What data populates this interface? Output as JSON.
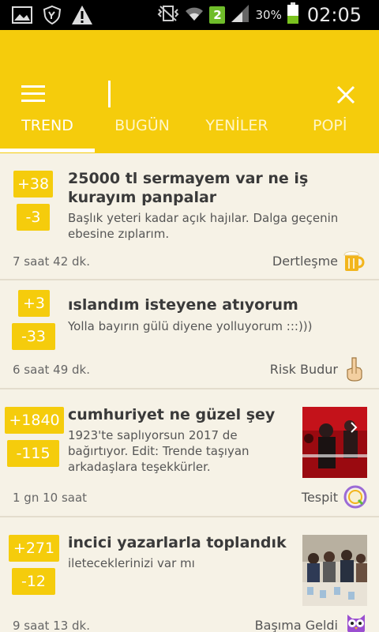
{
  "status_bar": {
    "icons_left": [
      "image-icon",
      "shield-hand-icon",
      "warning-icon"
    ],
    "icons_right": [
      "vibrate-icon",
      "wifi-icon",
      "sim2-icon",
      "signal-icon",
      "battery-icon"
    ],
    "sim_label": "2",
    "battery": "30%",
    "time": "02:05"
  },
  "app_bar": {
    "search_value": "",
    "tabs": [
      {
        "label": "TREND",
        "active": true
      },
      {
        "label": "BUGÜN",
        "active": false
      },
      {
        "label": "YENİLER",
        "active": false
      },
      {
        "label": "POPİ",
        "active": false
      }
    ]
  },
  "feed": [
    {
      "up": "+38",
      "down": "-3",
      "title": "25000 tl sermayem var ne iş kurayım panpalar",
      "body": "Başlık yeteri kadar açık hajılar. Dalga geçenin ebesine zıplarım.",
      "time": "7 saat 42 dk.",
      "category": "Dertleşme",
      "category_icon": "beer-mug-icon"
    },
    {
      "up": "+3",
      "down": "-33",
      "title": "ıslandım isteyene atıyorum",
      "body": "Yolla bayırın gülü diyene yolluyorum :::)))",
      "time": "6 saat 49 dk.",
      "category": "Risk Budur",
      "category_icon": "middle-finger-icon"
    },
    {
      "up": "+1840",
      "down": "-115",
      "title": "cumhuriyet ne güzel şey",
      "body": "1923'te saplıyorsun 2017 de bağırtıyor. Edit: Trende taşıyan arkadaşlara teşekkürler.",
      "time": "1 gn 10 saat",
      "category": "Tespit",
      "category_icon": "magnifier-icon",
      "thumbnail": "crowd-photo"
    },
    {
      "up": "+271",
      "down": "-12",
      "title": "incici yazarlarla toplandık",
      "body": "ileteceklerinizi var mı",
      "time": "9 saat 13 dk.",
      "category": "Başıma Geldi",
      "category_icon": "owl-icon",
      "thumbnail": "group-photo"
    }
  ],
  "colors": {
    "accent": "#f5cc0c",
    "background": "#f6f2e6"
  }
}
